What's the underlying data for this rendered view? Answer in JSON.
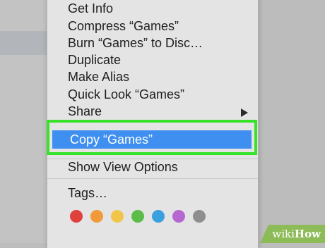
{
  "menu": {
    "items": [
      {
        "label": "Get Info"
      },
      {
        "label": "Compress “Games”"
      },
      {
        "label": "Burn “Games” to Disc…"
      },
      {
        "label": "Duplicate"
      },
      {
        "label": "Make Alias"
      },
      {
        "label": "Quick Look “Games”"
      },
      {
        "label": "Share",
        "submenu_icon": "chevron-right-icon"
      }
    ],
    "highlighted_item": {
      "label": "Copy “Games”"
    },
    "view_options": {
      "label": "Show View Options"
    },
    "tags": {
      "label": "Tags…",
      "colors": [
        "#e0413d",
        "#f09a3a",
        "#f1c54a",
        "#5bbd48",
        "#3aa0de",
        "#b768d0",
        "#8e8e8e"
      ],
      "names": [
        "red-tag",
        "orange-tag",
        "yellow-tag",
        "green-tag",
        "blue-tag",
        "purple-tag",
        "gray-tag"
      ]
    }
  },
  "colors": {
    "highlight_border": "#39e22a",
    "selection": "#3e8ff0"
  },
  "watermark": {
    "wiki": "wiki",
    "how": "How"
  }
}
